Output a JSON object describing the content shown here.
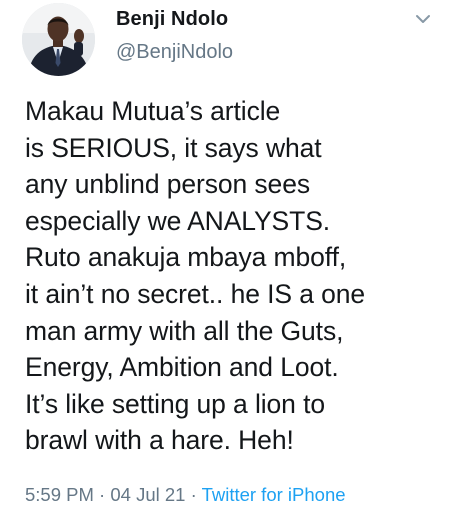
{
  "author": {
    "name": "Benji Ndolo",
    "handle": "@BenjiNdolo",
    "avatar_icon": "profile-photo"
  },
  "menu": {
    "icon": "chevron-down-icon"
  },
  "tweet": {
    "lines": [
      "Makau Mutua’s article",
      "is SERIOUS, it says what",
      "any unblind person sees",
      "especially we ANALYSTS.",
      "Ruto anakuja mbaya mboff,",
      "it ain’t no secret.. he IS a one",
      "man army with all the Guts,",
      "Energy, Ambition and Loot.",
      "It’s like setting up a lion to",
      "brawl with a hare. Heh!"
    ]
  },
  "meta": {
    "time": "5:59 PM",
    "separator": " · ",
    "date": "04 Jul 21",
    "source": "Twitter for iPhone"
  },
  "colors": {
    "text": "#14171a",
    "secondary": "#657786",
    "link": "#1da1f2"
  }
}
